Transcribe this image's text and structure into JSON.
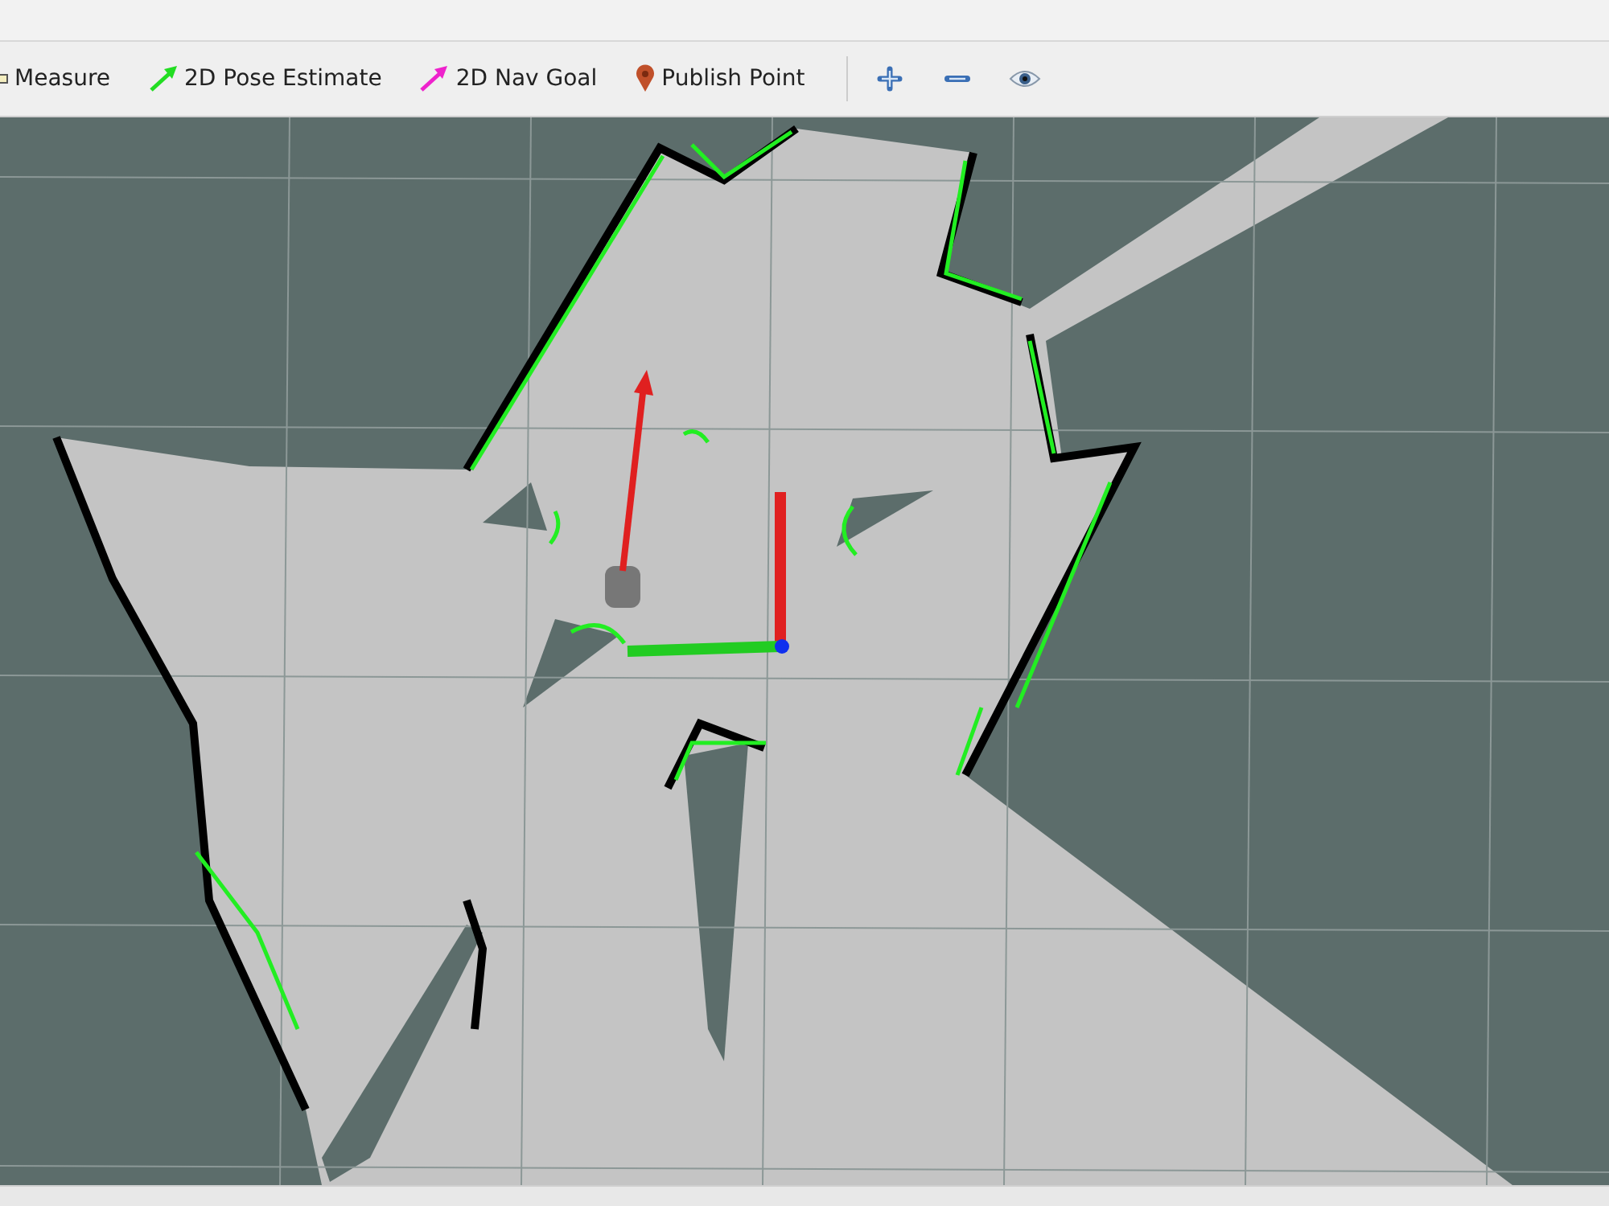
{
  "toolbar": {
    "tools": [
      {
        "kind": "measure",
        "label": "Measure"
      },
      {
        "kind": "pose",
        "label": "2D Pose Estimate"
      },
      {
        "kind": "goal",
        "label": "2D Nav Goal"
      },
      {
        "kind": "point",
        "label": "Publish Point"
      }
    ],
    "view_buttons": [
      {
        "kind": "zoom-in"
      },
      {
        "kind": "zoom-out"
      },
      {
        "kind": "eye"
      }
    ]
  }
}
